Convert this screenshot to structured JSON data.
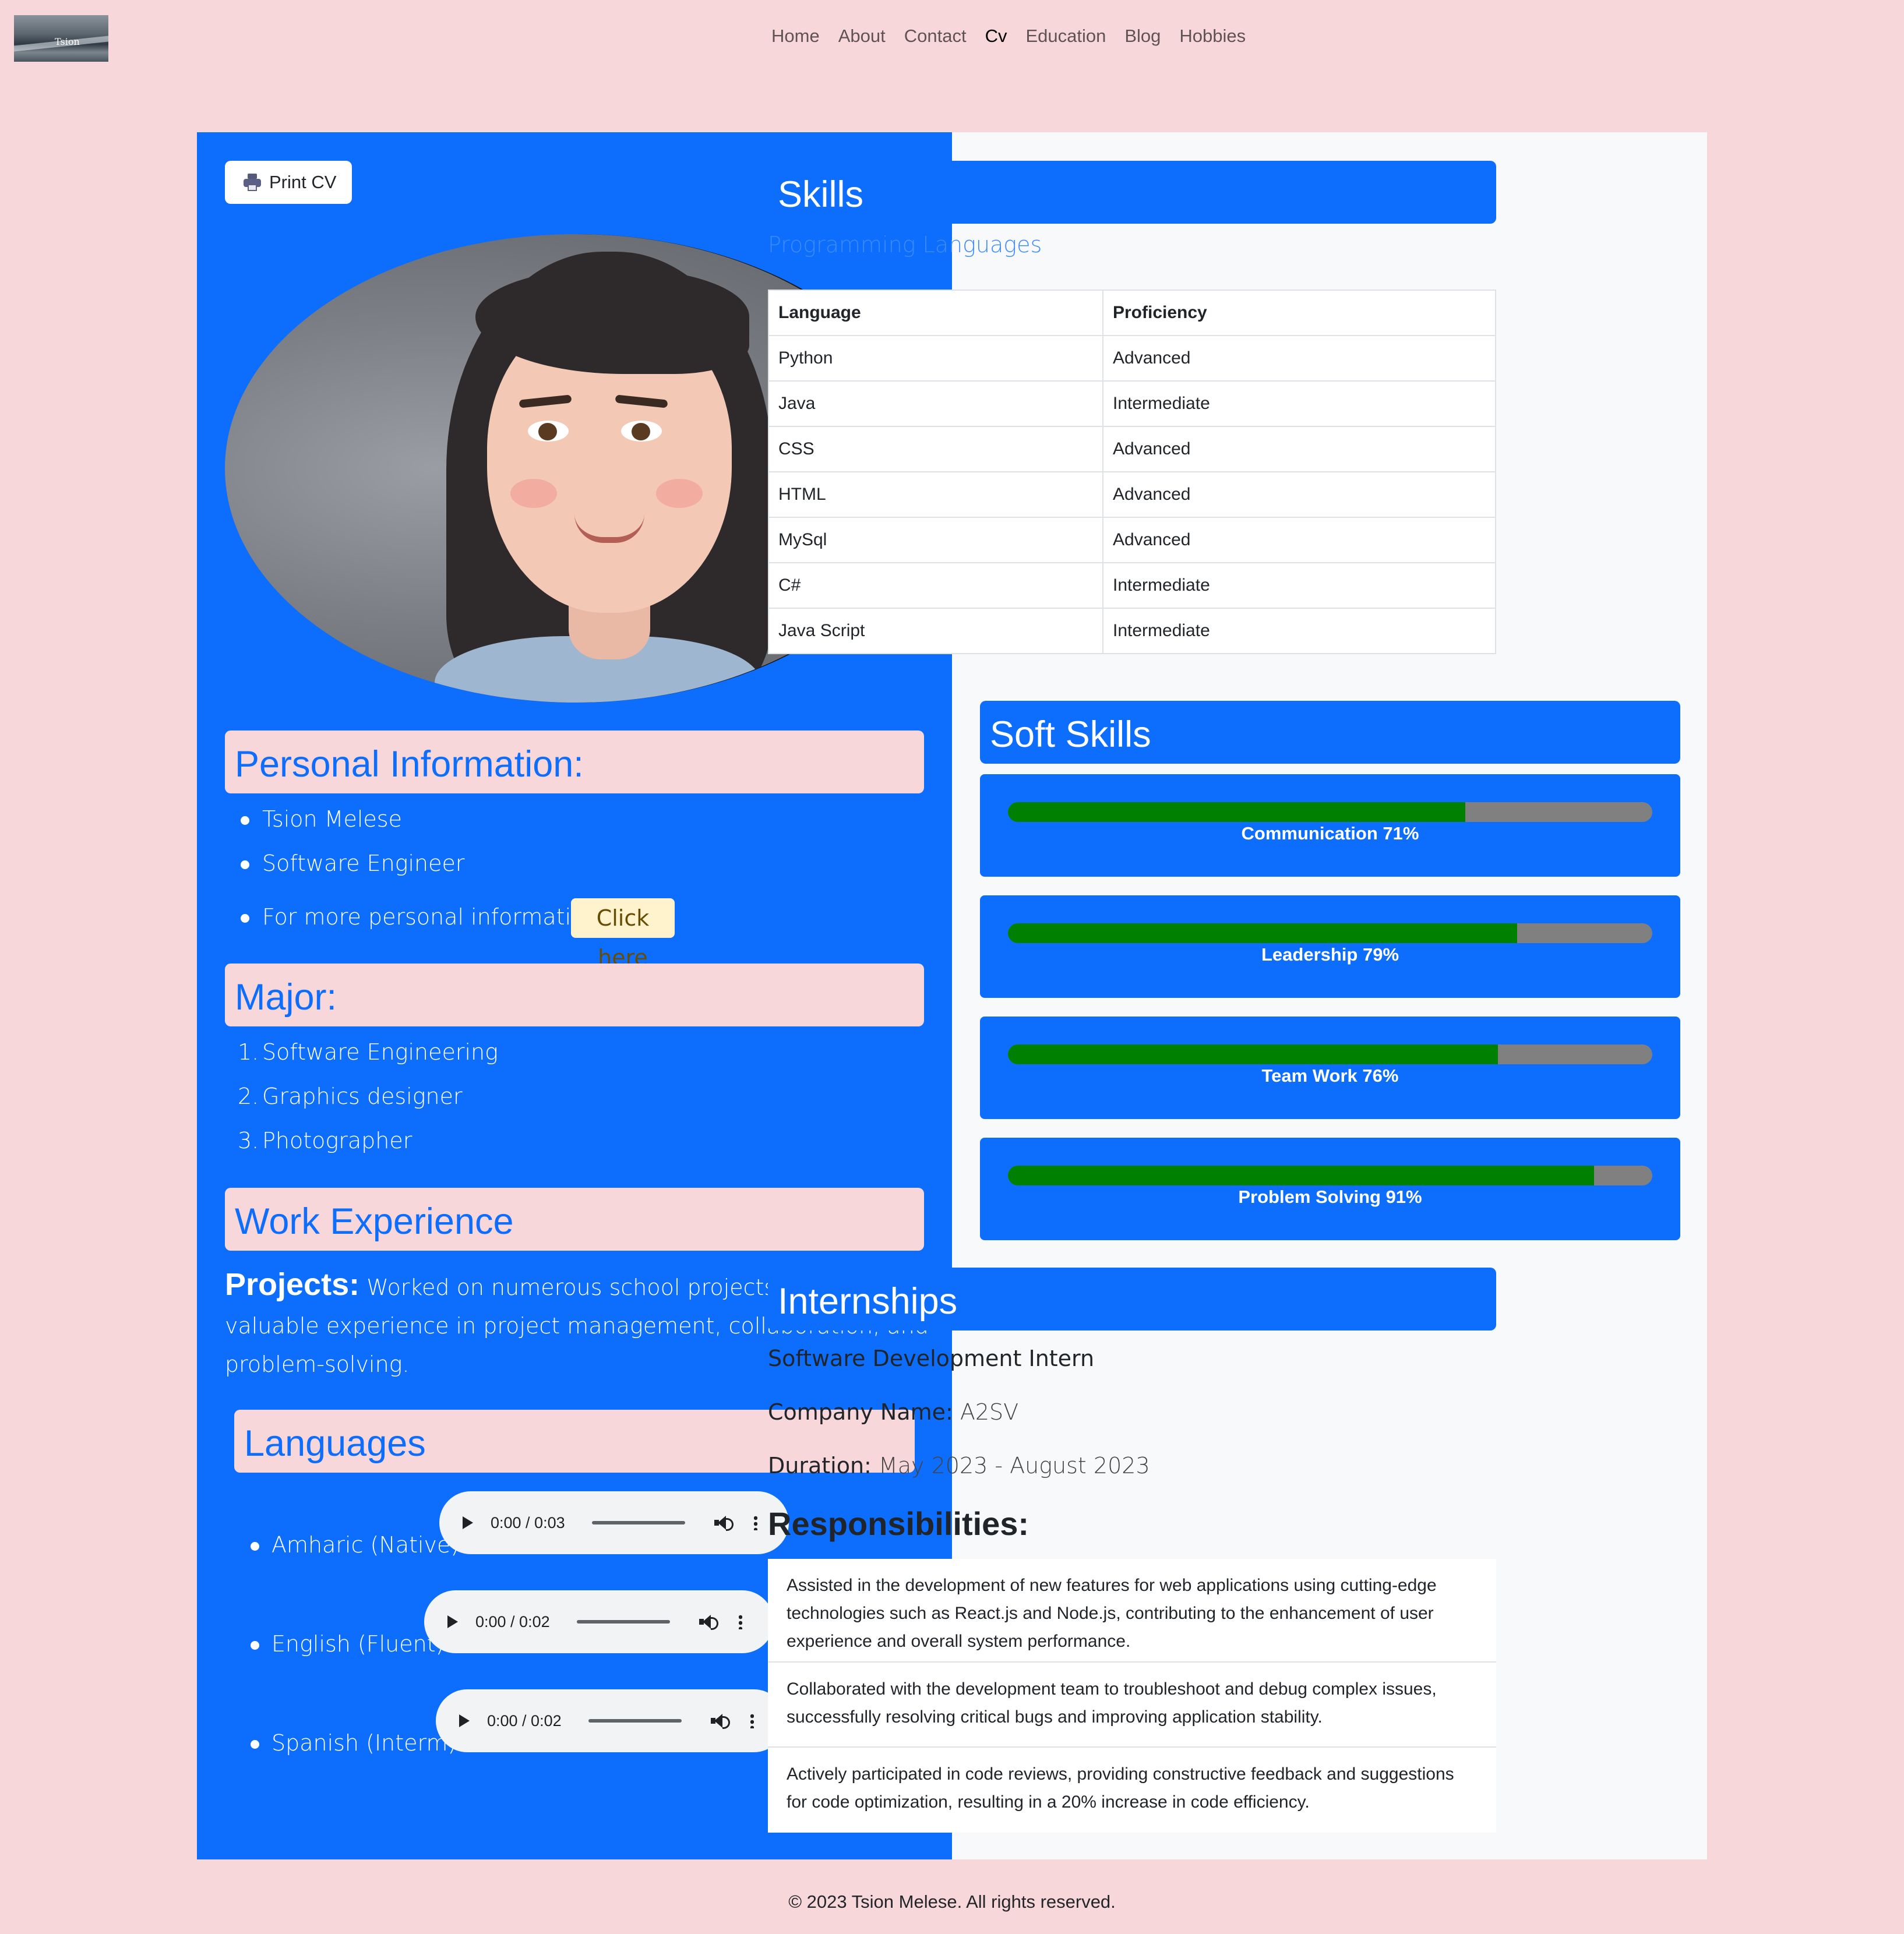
{
  "nav": {
    "logo_text": "Tsion",
    "links": [
      "Home",
      "About",
      "Contact",
      "Cv",
      "Education",
      "Blog",
      "Hobbies"
    ],
    "active": "Cv"
  },
  "print_label": "Print CV",
  "personal": {
    "heading": "Personal Information:",
    "name": "Tsion Melese",
    "title": "Software Engineer",
    "more_label": "For more personal information:",
    "click_label": "Click here"
  },
  "major": {
    "heading": "Major:",
    "items": [
      "Software Engineering",
      "Graphics designer",
      "Photographer"
    ]
  },
  "work": {
    "heading": "Work Experience",
    "projects_label": "Projects:",
    "projects_text": "Worked on numerous school projects, gaining valuable experience in project management, collaboration, and problem-solving."
  },
  "languages": {
    "heading": "Languages",
    "items": [
      {
        "label": "Amharic (Native)",
        "time": "0:00 / 0:03"
      },
      {
        "label": "English (Fluent)",
        "time": "0:00 / 0:02"
      },
      {
        "label": "Spanish (Interm)",
        "time": "0:00 / 0:02"
      }
    ]
  },
  "skills": {
    "heading": "Skills",
    "subtitle": "Programming Languages",
    "columns": [
      "Language",
      "Proficiency"
    ],
    "rows": [
      [
        "Python",
        "Advanced"
      ],
      [
        "Java",
        "Intermediate"
      ],
      [
        "CSS",
        "Advanced"
      ],
      [
        "HTML",
        "Advanced"
      ],
      [
        "MySql",
        "Advanced"
      ],
      [
        "C#",
        "Intermediate"
      ],
      [
        "Java Script",
        "Intermediate"
      ]
    ]
  },
  "soft_skills": {
    "heading": "Soft Skills",
    "items": [
      {
        "label": "Communication 71%",
        "percent": 71
      },
      {
        "label": "Leadership 79%",
        "percent": 79
      },
      {
        "label": "Team Work 76%",
        "percent": 76
      },
      {
        "label": "Problem Solving 91%",
        "percent": 91
      }
    ],
    "fill_color": "#008000",
    "track_color": "#808080"
  },
  "internships": {
    "heading": "Internships",
    "role": "Software Development Intern",
    "company_label": "Company Name:",
    "company": "A2SV",
    "duration_label": "Duration:",
    "duration": "May 2023 - August 2023",
    "resp_heading": "Responsibilities:",
    "responsibilities": [
      "Assisted in the development of new features for web applications using cutting-edge technologies such as React.js and Node.js, contributing to the enhancement of user experience and overall system performance.",
      "Collaborated with the development team to troubleshoot and debug complex issues, successfully resolving critical bugs and improving application stability.",
      "Actively participated in code reviews, providing constructive feedback and suggestions for code optimization, resulting in a 20% increase in code efficiency."
    ]
  },
  "footer": "© 2023 Tsion Melese. All rights reserved.",
  "colors": {
    "page": "#f8d7da",
    "primary": "#0d6efd",
    "panel": "#f8f9fa"
  }
}
